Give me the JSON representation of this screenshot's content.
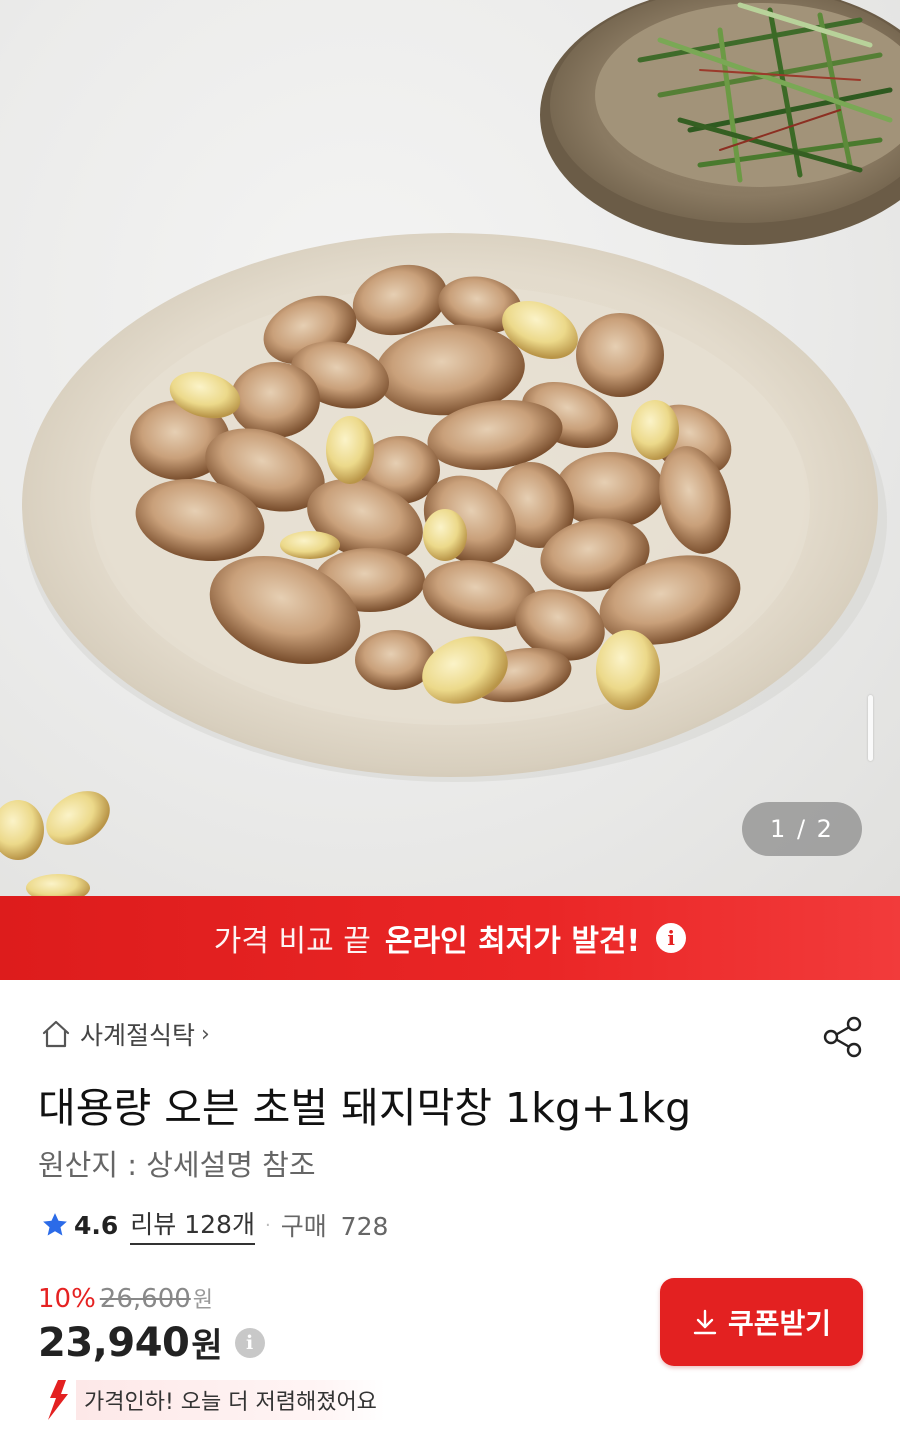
{
  "hero": {
    "image_alt": "",
    "page_counter": "1 / 2"
  },
  "promo": {
    "light_text": "가격 비교 끝",
    "bold_text": "온라인 최저가 발견!",
    "info_glyph": "i"
  },
  "store": {
    "name": "사계절식탁",
    "chevron": "›"
  },
  "product": {
    "title": "대용량 오븐 초벌 돼지막창 1kg+1kg",
    "origin": "원산지 : 상세설명 참조"
  },
  "rating": {
    "score": "4.6",
    "review_label": "리뷰 128개",
    "separator": "·",
    "purchase_label": "구매",
    "purchase_count": "728"
  },
  "price": {
    "discount_pct": "10%",
    "original": "26,600",
    "original_unit": "원",
    "final": "23,940",
    "final_unit": "원",
    "info_glyph": "i"
  },
  "price_drop": {
    "text": "가격인하! 오늘 더 저렴해졌어요"
  },
  "coupon": {
    "label": "쿠폰받기"
  },
  "icons": {
    "home": "home-icon",
    "share": "share-icon",
    "star": "star-icon",
    "download": "download-icon",
    "drop_arrow": "price-drop-arrow-icon"
  },
  "colors": {
    "accent_red": "#e32121",
    "star_blue": "#2b6be8"
  }
}
